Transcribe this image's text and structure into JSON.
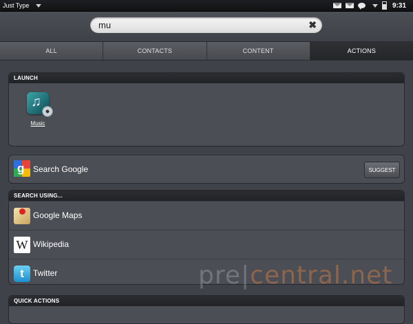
{
  "status_bar": {
    "app_name": "Just Type",
    "time": "9:31",
    "icons": [
      "email-icon",
      "email-icon",
      "chat-icon",
      "dropdown-caret-icon",
      "battery-icon"
    ]
  },
  "search": {
    "query": "mu",
    "clear_icon": "close-icon"
  },
  "tabs": [
    {
      "label": "ALL",
      "active": false
    },
    {
      "label": "CONTACTS",
      "active": false
    },
    {
      "label": "CONTENT",
      "active": false
    },
    {
      "label": "ACTIONS",
      "active": true
    }
  ],
  "launch": {
    "header": "LAUNCH",
    "apps": [
      {
        "label": "Music",
        "icon": "music-app-icon"
      }
    ]
  },
  "google": {
    "label": "Search Google",
    "icon": "google-icon",
    "suggest_label": "SUGGEST"
  },
  "search_using": {
    "header": "SEARCH USING...",
    "items": [
      {
        "label": "Google Maps",
        "icon": "google-maps-icon"
      },
      {
        "label": "Wikipedia",
        "icon": "wikipedia-icon"
      },
      {
        "label": "Twitter",
        "icon": "twitter-icon"
      }
    ]
  },
  "quick_actions": {
    "header": "QUICK ACTIONS"
  },
  "watermark": {
    "part1": "pre",
    "separator": "|",
    "part2": "central.net"
  }
}
